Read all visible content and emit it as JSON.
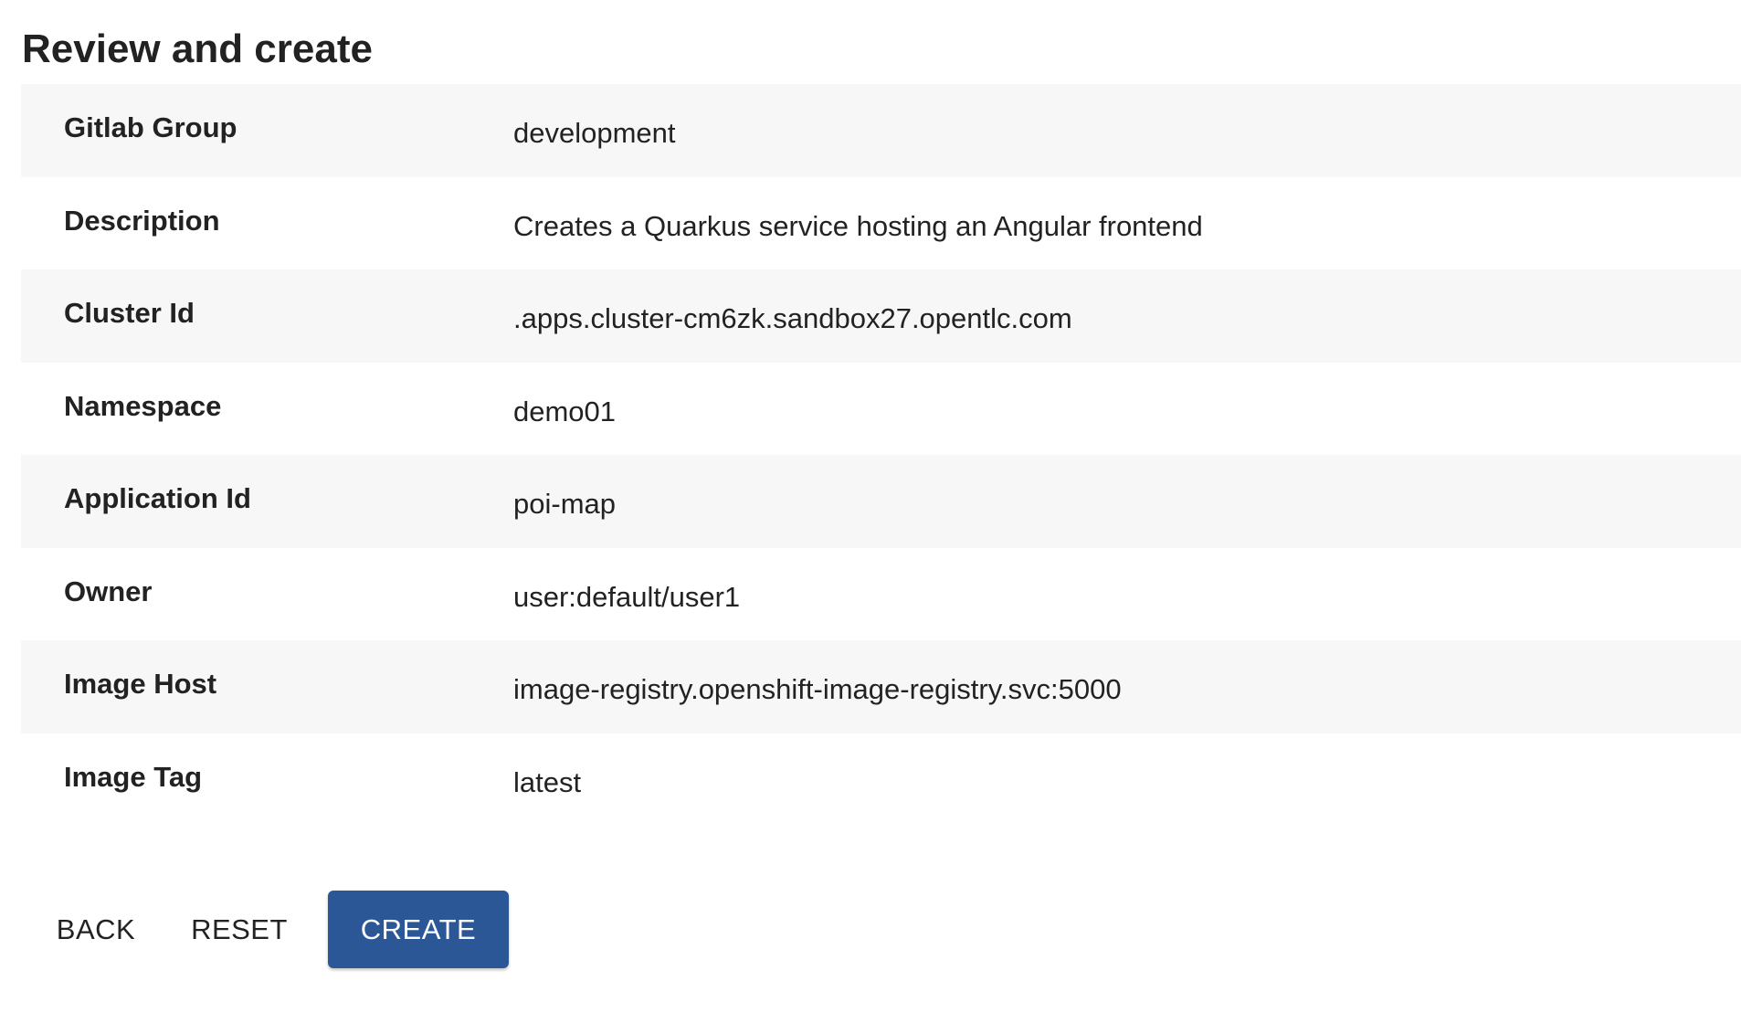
{
  "page": {
    "title": "Review and create"
  },
  "review": {
    "rows": [
      {
        "label": "Gitlab Group",
        "value": "development"
      },
      {
        "label": "Description",
        "value": "Creates a Quarkus service hosting an Angular frontend"
      },
      {
        "label": "Cluster Id",
        "value": ".apps.cluster-cm6zk.sandbox27.opentlc.com"
      },
      {
        "label": "Namespace",
        "value": "demo01"
      },
      {
        "label": "Application Id",
        "value": "poi-map"
      },
      {
        "label": "Owner",
        "value": "user:default/user1"
      },
      {
        "label": "Image Host",
        "value": "image-registry.openshift-image-registry.svc:5000"
      },
      {
        "label": "Image Tag",
        "value": "latest"
      }
    ]
  },
  "actions": {
    "back_label": "BACK",
    "reset_label": "RESET",
    "create_label": "CREATE"
  },
  "colors": {
    "primary": "#2c5796",
    "row_alt": "#f7f7f7"
  }
}
